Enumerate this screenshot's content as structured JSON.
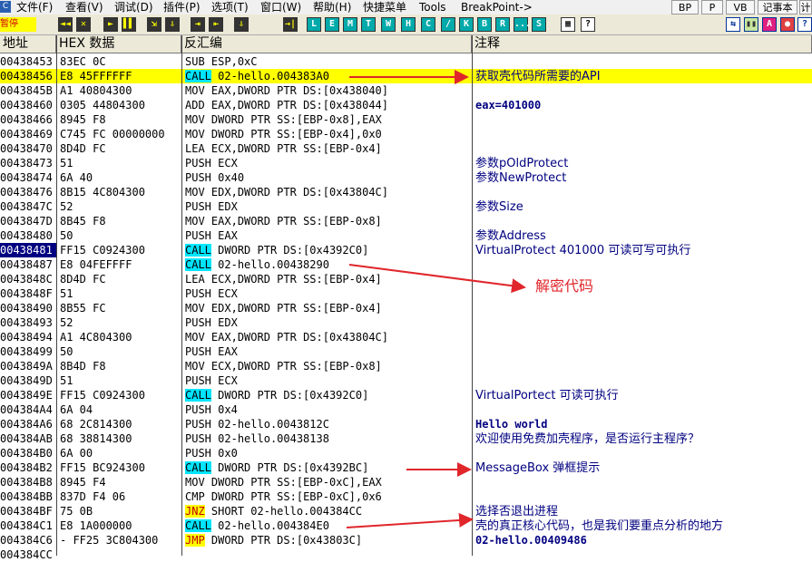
{
  "menu": {
    "logo": "C",
    "items": [
      "文件(F)",
      "查看(V)",
      "调试(D)",
      "插件(P)",
      "选项(T)",
      "窗口(W)",
      "帮助(H)",
      "快捷菜单",
      "Tools",
      "BreakPoint->"
    ],
    "right_buttons": [
      "BP",
      "P",
      "VB",
      "记事本",
      "计"
    ]
  },
  "toolbar": {
    "status": "暂停",
    "buttons_left": [
      "◄◄",
      "✕",
      "►",
      "▌▌",
      "⇲",
      "⇩",
      "⇥",
      "⇤",
      "⇩",
      "→|"
    ],
    "buttons_letters": [
      "L",
      "E",
      "M",
      "T",
      "W",
      "H",
      "C",
      "/",
      "K",
      "B",
      "R",
      "...",
      "S"
    ],
    "buttons_grid": [
      "▦",
      "?"
    ],
    "buttons_right": [
      "⇆",
      "▮▮",
      "A",
      "●",
      "?"
    ]
  },
  "columns": {
    "address": "地址",
    "hex": "HEX 数据",
    "disasm": "反汇编",
    "comment": "注释"
  },
  "rows": [
    {
      "addr": "00438453",
      "hex": "83EC 0C",
      "mn": "SUB",
      "ops": "ESP,0xC",
      "cmt": ""
    },
    {
      "addr": "00438456",
      "hex": "E8 45FFFFFF",
      "mn": "CALL",
      "ops": "02-hello.004383A0",
      "cmt": "获取壳代码所需要的API",
      "hl": true
    },
    {
      "addr": "0043845B",
      "hex": "A1 40804300",
      "mn": "MOV",
      "ops": "EAX,DWORD PTR DS:[0x438040]",
      "cmt": ""
    },
    {
      "addr": "00438460",
      "hex": "0305 44804300",
      "mn": "ADD",
      "ops": "EAX,DWORD PTR DS:[0x438044]",
      "cmt": "eax=401000"
    },
    {
      "addr": "00438466",
      "hex": "8945 F8",
      "mn": "MOV",
      "ops": "DWORD PTR SS:[EBP-0x8],EAX",
      "cmt": ""
    },
    {
      "addr": "00438469",
      "hex": "C745 FC 00000000",
      "mn": "MOV",
      "ops": "DWORD PTR SS:[EBP-0x4],0x0",
      "cmt": ""
    },
    {
      "addr": "00438470",
      "hex": "8D4D FC",
      "mn": "LEA",
      "ops": "ECX,DWORD PTR SS:[EBP-0x4]",
      "cmt": ""
    },
    {
      "addr": "00438473",
      "hex": "51",
      "mn": "PUSH",
      "ops": "ECX",
      "cmt": "参数pOldProtect"
    },
    {
      "addr": "00438474",
      "hex": "6A 40",
      "mn": "PUSH",
      "ops": "0x40",
      "cmt": "参数NewProtect"
    },
    {
      "addr": "00438476",
      "hex": "8B15 4C804300",
      "mn": "MOV",
      "ops": "EDX,DWORD PTR DS:[0x43804C]",
      "cmt": ""
    },
    {
      "addr": "0043847C",
      "hex": "52",
      "mn": "PUSH",
      "ops": "EDX",
      "cmt": "参数Size"
    },
    {
      "addr": "0043847D",
      "hex": "8B45 F8",
      "mn": "MOV",
      "ops": "EAX,DWORD PTR SS:[EBP-0x8]",
      "cmt": ""
    },
    {
      "addr": "00438480",
      "hex": "50",
      "mn": "PUSH",
      "ops": "EAX",
      "cmt": "参数Address"
    },
    {
      "addr": "00438481",
      "hex": "FF15 C0924300",
      "mn": "CALL",
      "ops": "DWORD PTR DS:[0x4392C0]",
      "cmt": "VirtualProtect  401000 可读可写可执行",
      "sel": true
    },
    {
      "addr": "00438487",
      "hex": "E8 04FEFFFF",
      "mn": "CALL",
      "ops": "02-hello.00438290",
      "cmt": ""
    },
    {
      "addr": "0043848C",
      "hex": "8D4D FC",
      "mn": "LEA",
      "ops": "ECX,DWORD PTR SS:[EBP-0x4]",
      "cmt": ""
    },
    {
      "addr": "0043848F",
      "hex": "51",
      "mn": "PUSH",
      "ops": "ECX",
      "cmt": ""
    },
    {
      "addr": "00438490",
      "hex": "8B55 FC",
      "mn": "MOV",
      "ops": "EDX,DWORD PTR SS:[EBP-0x4]",
      "cmt": ""
    },
    {
      "addr": "00438493",
      "hex": "52",
      "mn": "PUSH",
      "ops": "EDX",
      "cmt": ""
    },
    {
      "addr": "00438494",
      "hex": "A1 4C804300",
      "mn": "MOV",
      "ops": "EAX,DWORD PTR DS:[0x43804C]",
      "cmt": ""
    },
    {
      "addr": "00438499",
      "hex": "50",
      "mn": "PUSH",
      "ops": "EAX",
      "cmt": ""
    },
    {
      "addr": "0043849A",
      "hex": "8B4D F8",
      "mn": "MOV",
      "ops": "ECX,DWORD PTR SS:[EBP-0x8]",
      "cmt": ""
    },
    {
      "addr": "0043849D",
      "hex": "51",
      "mn": "PUSH",
      "ops": "ECX",
      "cmt": ""
    },
    {
      "addr": "0043849E",
      "hex": "FF15 C0924300",
      "mn": "CALL",
      "ops": "DWORD PTR DS:[0x4392C0]",
      "cmt": "VirtualPortect 可读可执行"
    },
    {
      "addr": "004384A4",
      "hex": "6A 04",
      "mn": "PUSH",
      "ops": "0x4",
      "cmt": ""
    },
    {
      "addr": "004384A6",
      "hex": "68 2C814300",
      "mn": "PUSH",
      "ops": "02-hello.0043812C",
      "cmt": "Hello world"
    },
    {
      "addr": "004384AB",
      "hex": "68 38814300",
      "mn": "PUSH",
      "ops": "02-hello.00438138",
      "cmt": "欢迎使用免费加壳程序，是否运行主程序？"
    },
    {
      "addr": "004384B0",
      "hex": "6A 00",
      "mn": "PUSH",
      "ops": "0x0",
      "cmt": ""
    },
    {
      "addr": "004384B2",
      "hex": "FF15 BC924300",
      "mn": "CALL",
      "ops": "DWORD PTR DS:[0x4392BC]",
      "cmt": "MessageBox 弹框提示"
    },
    {
      "addr": "004384B8",
      "hex": "8945 F4",
      "mn": "MOV",
      "ops": "DWORD PTR SS:[EBP-0xC],EAX",
      "cmt": ""
    },
    {
      "addr": "004384BB",
      "hex": "837D F4 06",
      "mn": "CMP",
      "ops": "DWORD PTR SS:[EBP-0xC],0x6",
      "cmt": ""
    },
    {
      "addr": "004384BF",
      "hex": "75 0B",
      "mn": "JNZ",
      "ops": "SHORT 02-hello.004384CC",
      "cmt": "选择否退出进程"
    },
    {
      "addr": "004384C1",
      "hex": "E8 1A000000",
      "mn": "CALL",
      "ops": "02-hello.004384E0",
      "cmt": "壳的真正核心代码，也是我们要重点分析的地方"
    },
    {
      "addr": "004384C6",
      "hex": "- FF25 3C804300",
      "mn": "JMP",
      "ops": "DWORD PTR DS:[0x43803C]",
      "cmt": "02-hello.00409486"
    },
    {
      "addr": "004384CC",
      "hex": "",
      "mn": "",
      "ops": "",
      "cmt": ""
    }
  ],
  "annotations": {
    "decrypt_label": "解密代码"
  }
}
